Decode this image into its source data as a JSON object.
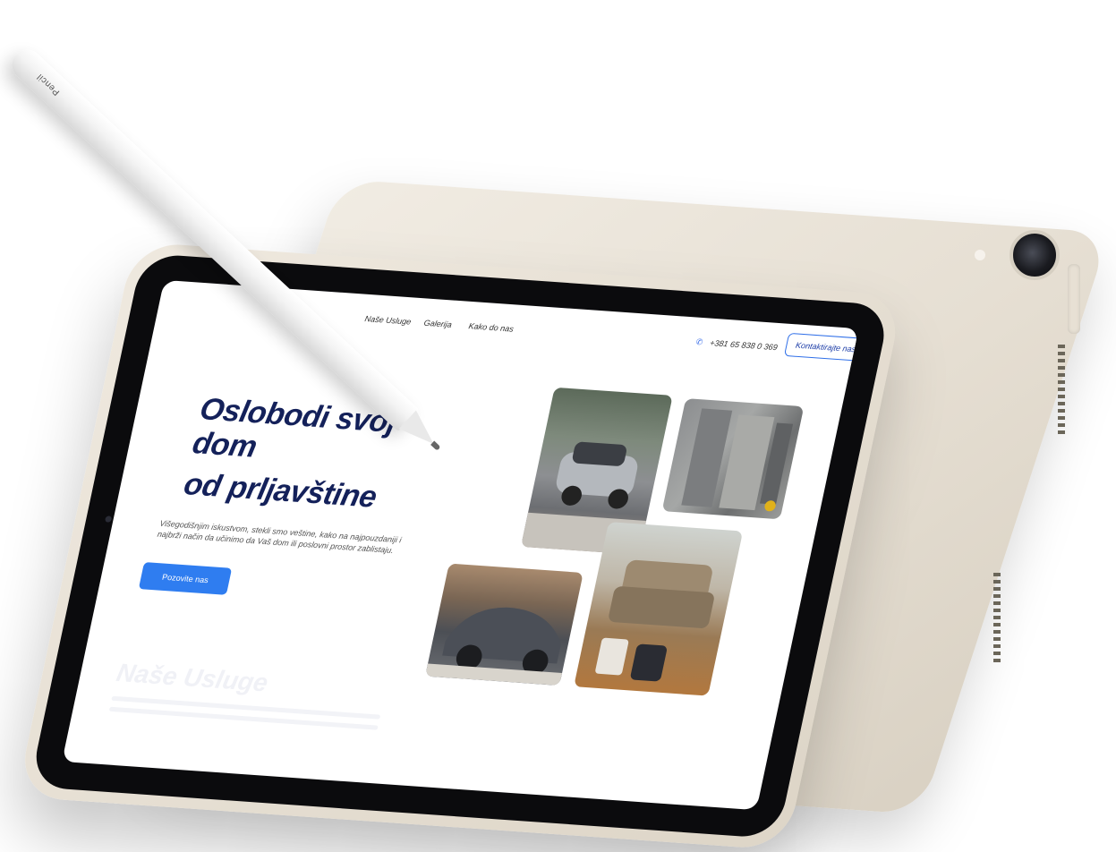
{
  "nav": {
    "links": [
      "Naše Usluge",
      "Galerija",
      "Kako do nas"
    ],
    "phone": "+381 65 838 0 369",
    "phone_icon": "phone-icon",
    "cta_label": "Kontaktirajte nas"
  },
  "hero": {
    "title_line1": "Oslobodi svoj",
    "title_line2": "dom",
    "title_line3": "od prljavštine",
    "subtitle": "Višegodišnjim iskustvom, stekli smo veštine, kako na najpouzdaniji i najbrži način da učinimo da Vaš dom ili poslovni prostor zablistaju.",
    "button_label": "Pozovite nas"
  },
  "section": {
    "title": "Naše Usluge"
  },
  "pencil": {
    "brand": "Pencil"
  },
  "colors": {
    "accent": "#2f7df0",
    "heading": "#14215a",
    "device": "#e8e1d5"
  }
}
